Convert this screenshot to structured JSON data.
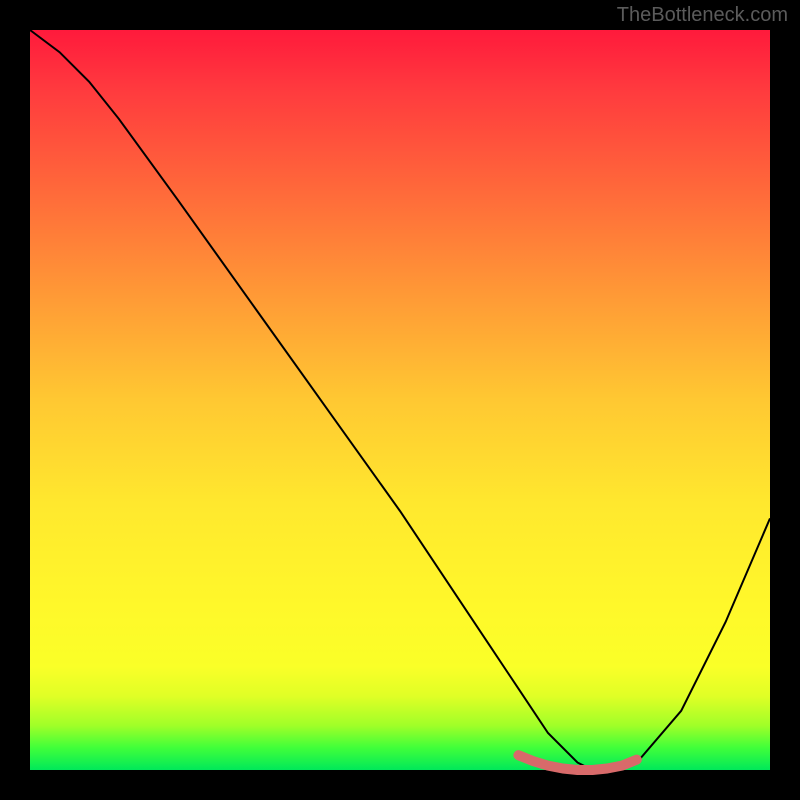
{
  "watermark": "TheBottleneck.com",
  "chart_data": {
    "type": "line",
    "title": "",
    "xlabel": "",
    "ylabel": "",
    "xlim": [
      0,
      100
    ],
    "ylim": [
      0,
      100
    ],
    "series": [
      {
        "name": "bottleneck-curve",
        "x": [
          0,
          4,
          8,
          12,
          20,
          30,
          40,
          50,
          58,
          62,
          66,
          70,
          74,
          76,
          78,
          82,
          88,
          94,
          100
        ],
        "values": [
          100,
          97,
          93,
          88,
          77,
          63,
          49,
          35,
          23,
          17,
          11,
          5,
          1,
          0,
          0,
          1,
          8,
          20,
          34
        ],
        "color": "#000000"
      },
      {
        "name": "optimal-range-marker",
        "x": [
          66,
          68,
          70,
          72,
          74,
          76,
          78,
          80,
          82
        ],
        "values": [
          2,
          1.2,
          0.6,
          0.2,
          0,
          0,
          0.2,
          0.6,
          1.4
        ],
        "color": "#d86a6a"
      }
    ],
    "gradient_stops": [
      {
        "pos": 0,
        "color": "#ff1a3c"
      },
      {
        "pos": 50,
        "color": "#ffc832"
      },
      {
        "pos": 86,
        "color": "#faff28"
      },
      {
        "pos": 100,
        "color": "#00e85a"
      }
    ]
  }
}
